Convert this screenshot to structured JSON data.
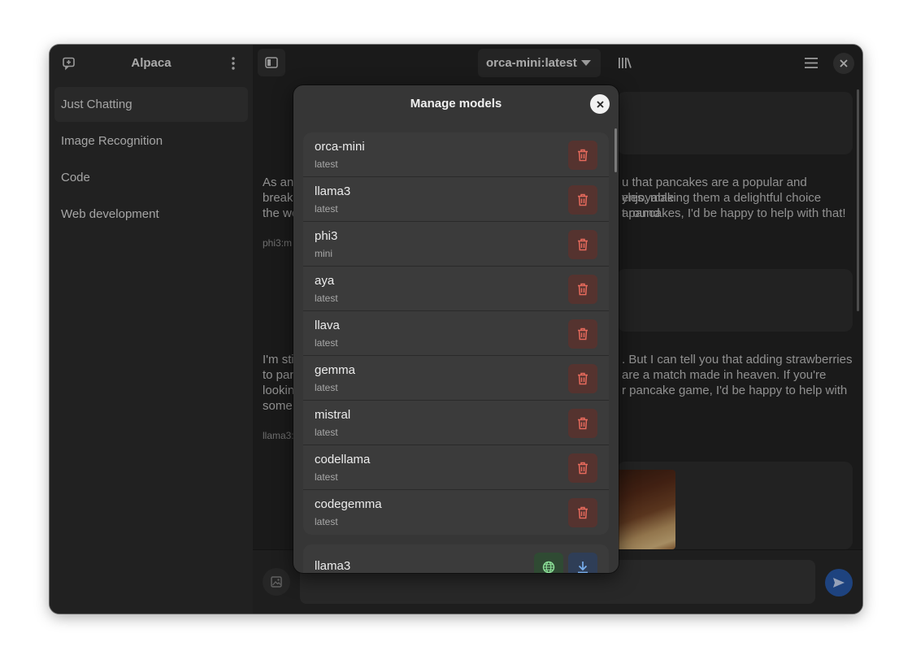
{
  "app": {
    "title": "Alpaca"
  },
  "sidebar": {
    "chats": [
      {
        "label": "Just Chatting",
        "active": true
      },
      {
        "label": "Image Recognition"
      },
      {
        "label": "Code"
      },
      {
        "label": "Web development"
      }
    ]
  },
  "header": {
    "model_selector": "orca-mini:latest"
  },
  "messages": [
    {
      "text_1": "As an",
      "text_2": "break",
      "text_3": "the wo",
      "right_1": "u that pancakes are a popular and enjoyable",
      "right_2": "yles, making them a delightful choice around",
      "right_3": "t pancakes, I'd be happy to help with that!",
      "meta": "phi3:m"
    },
    {
      "text_1": "I'm sti",
      "text_2": "to par",
      "text_3": "lookin",
      "text_4": "some",
      "right_1": ". But I can tell you that adding strawberries",
      "right_2": "are a match made in heaven. If you're",
      "right_3": "r pancake game, I'd be happy to help with",
      "right_4": "",
      "meta": "llama3:"
    }
  ],
  "input": {
    "placeholder": ""
  },
  "dialog": {
    "title": "Manage models",
    "local_models": [
      {
        "name": "orca-mini",
        "tag": "latest"
      },
      {
        "name": "llama3",
        "tag": "latest"
      },
      {
        "name": "phi3",
        "tag": "mini"
      },
      {
        "name": "aya",
        "tag": "latest"
      },
      {
        "name": "llava",
        "tag": "latest"
      },
      {
        "name": "gemma",
        "tag": "latest"
      },
      {
        "name": "mistral",
        "tag": "latest"
      },
      {
        "name": "codellama",
        "tag": "latest"
      },
      {
        "name": "codegemma",
        "tag": "latest"
      }
    ],
    "available_models": [
      {
        "name": "llama3"
      }
    ]
  },
  "colors": {
    "accent": "#2a5db0",
    "destructive": "#e66a5c",
    "success": "#8ee39a",
    "download": "#78aeed"
  }
}
